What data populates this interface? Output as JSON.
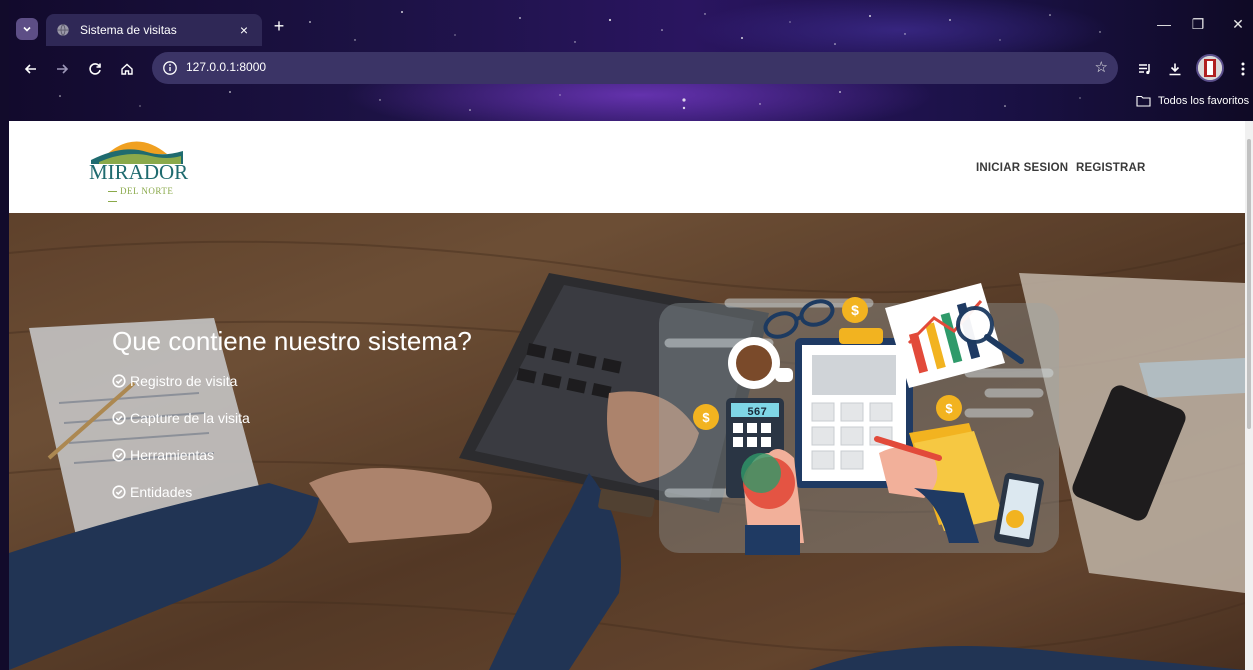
{
  "browser": {
    "tab_title": "Sistema de visitas",
    "tab_close": "×",
    "new_tab": "+",
    "url": "127.0.0.1:8000",
    "bookmarks_label": "Todos los favoritos",
    "controls": {
      "minimize": "—",
      "restore": "❐",
      "close": "✕"
    }
  },
  "header": {
    "logo_word": "MIRADOR",
    "logo_sub": "DEL NORTE",
    "nav": [
      {
        "label": "INICIAR SESION"
      },
      {
        "label": "REGISTRAR"
      }
    ]
  },
  "hero": {
    "title": "Que contiene nuestro sistema?",
    "features": [
      {
        "label": "Registro de visita"
      },
      {
        "label": "Capture de la visita"
      },
      {
        "label": "Herramientas"
      },
      {
        "label": "Entidades"
      }
    ],
    "calculator_display": "567"
  },
  "colors": {
    "brand_teal": "#1f6b6f",
    "brand_green": "#8aa94a",
    "brand_sun": "#f0a020",
    "chrome_bg": "#1c1244"
  },
  "icons": [
    "tab-menu-icon",
    "globe-icon",
    "back-icon",
    "forward-icon",
    "reload-icon",
    "home-icon",
    "info-icon",
    "star-icon",
    "media-icon",
    "download-icon",
    "kebab-menu-icon",
    "folder-icon",
    "check-circle-icon"
  ]
}
